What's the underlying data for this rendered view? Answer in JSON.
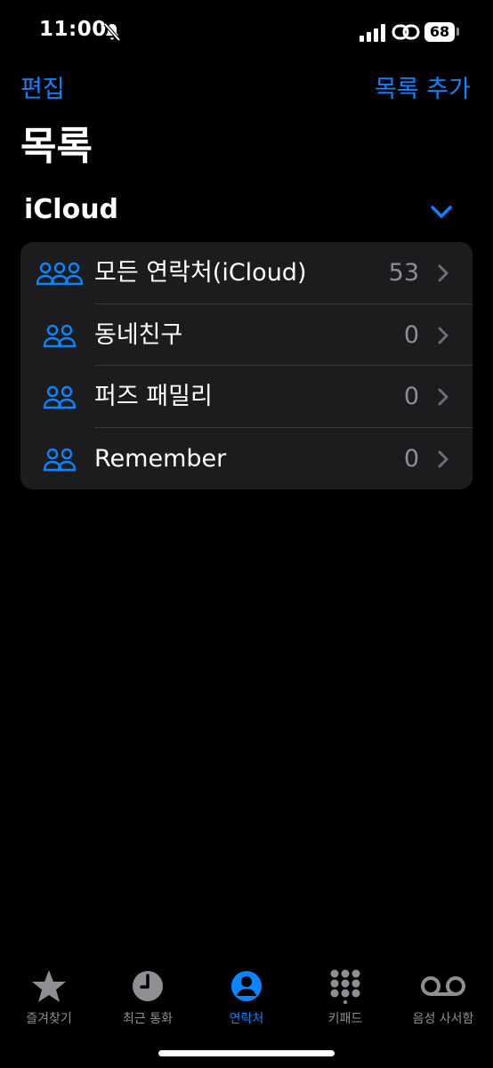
{
  "status_bar": {
    "time": "11:00",
    "battery": "68"
  },
  "nav": {
    "edit_label": "편집",
    "add_list_label": "목록 추가"
  },
  "page": {
    "title": "목록"
  },
  "section": {
    "header": "iCloud"
  },
  "lists": [
    {
      "label": "모든 연락처(iCloud)",
      "count": "53",
      "icon": "group-3-people-icon"
    },
    {
      "label": "동네친구",
      "count": "0",
      "icon": "group-2-people-icon"
    },
    {
      "label": "퍼즈 패밀리",
      "count": "0",
      "icon": "group-2-people-icon"
    },
    {
      "label": "Remember",
      "count": "0",
      "icon": "group-2-people-icon"
    }
  ],
  "tab_bar": {
    "tabs": [
      {
        "label": "즐겨찾기",
        "icon": "star-icon",
        "active": false
      },
      {
        "label": "최근 통화",
        "icon": "clock-icon",
        "active": false
      },
      {
        "label": "연락처",
        "icon": "person-circle-icon",
        "active": true
      },
      {
        "label": "키패드",
        "icon": "keypad-icon",
        "active": false
      },
      {
        "label": "음성 사서함",
        "icon": "voicemail-icon",
        "active": false
      }
    ]
  },
  "colors": {
    "accent": "#0a84ff",
    "background": "#000000",
    "group_background": "#1c1c1e",
    "secondary_text": "#8e8e93"
  }
}
